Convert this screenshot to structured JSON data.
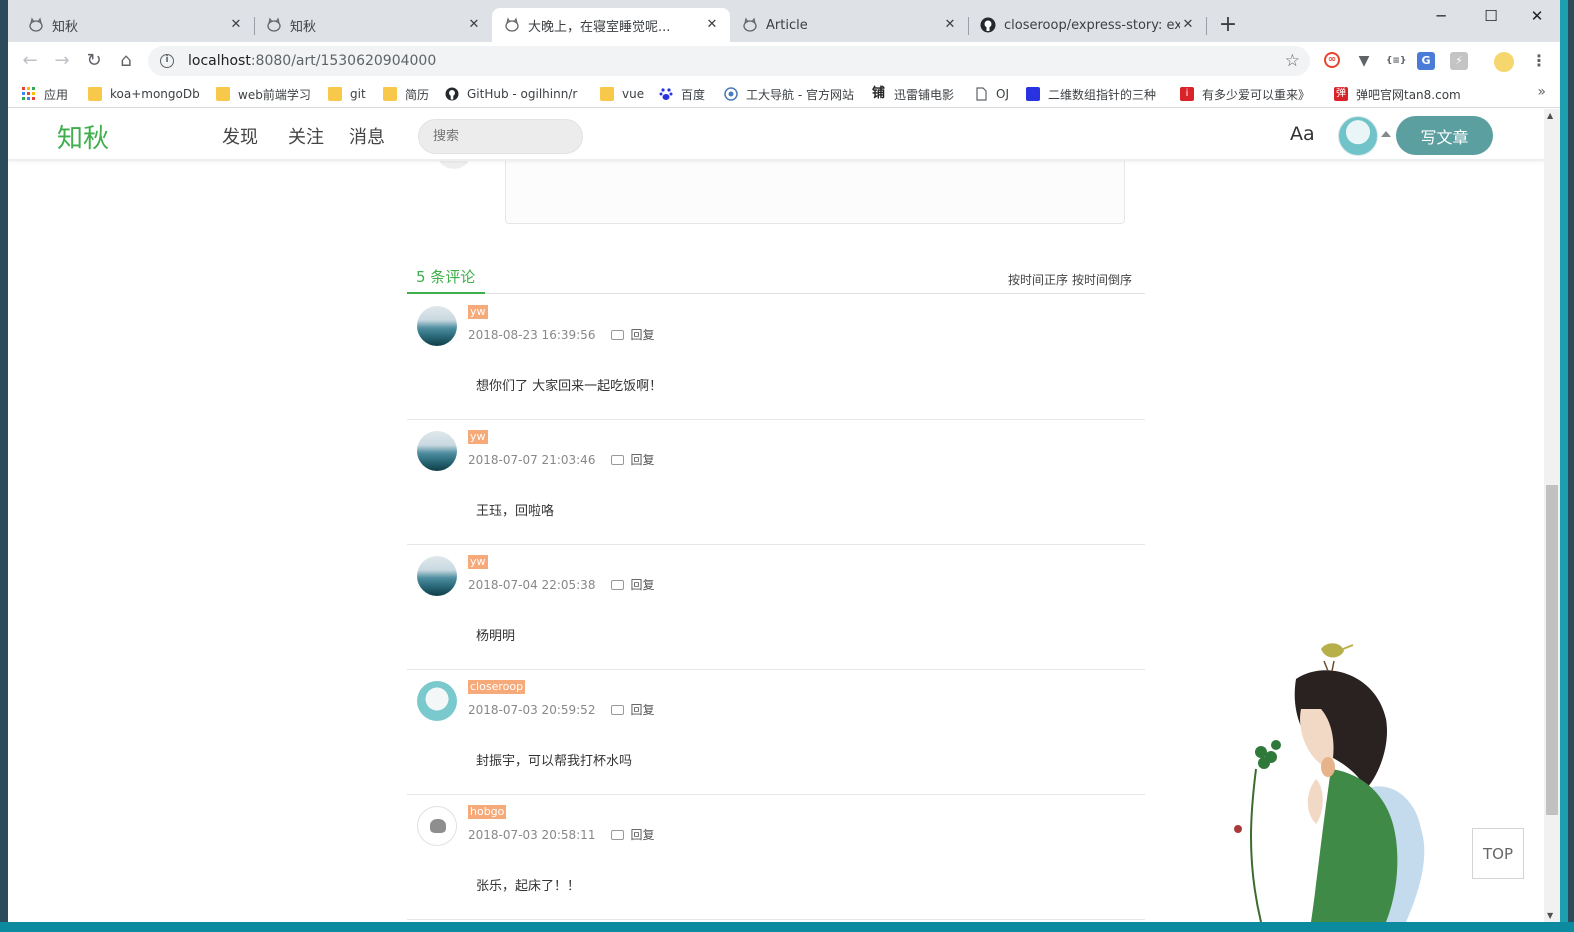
{
  "browser": {
    "tabs": [
      {
        "title": "知秋",
        "active": false
      },
      {
        "title": "知秋",
        "active": false
      },
      {
        "title": "大晚上，在寝室睡觉呢...",
        "active": true
      },
      {
        "title": "Article",
        "active": false
      },
      {
        "title": "closeroop/express-story: expre",
        "active": false
      }
    ],
    "tab_close": "✕",
    "new_tab": "+",
    "window_controls": {
      "minimize": "─",
      "maximize": "☐",
      "close": "✕"
    },
    "nav": {
      "back": "←",
      "forward": "→",
      "reload": "↻",
      "home": "⌂"
    },
    "url_host": "localhost",
    "url_path": ":8080/art/1530620904000",
    "star": "☆",
    "bookmarks": [
      {
        "label": "应用",
        "icon": "apps-grid-icon"
      },
      {
        "label": "koa+mongoDb",
        "icon": "folder-icon"
      },
      {
        "label": "web前端学习",
        "icon": "folder-icon"
      },
      {
        "label": "git",
        "icon": "folder-icon"
      },
      {
        "label": "简历",
        "icon": "folder-icon"
      },
      {
        "label": "GitHub - ogilhinn/r",
        "icon": "github-icon"
      },
      {
        "label": "vue",
        "icon": "folder-icon"
      },
      {
        "label": "百度",
        "icon": "baidu-icon"
      },
      {
        "label": "工大导航 - 官方网站",
        "icon": "globe-icon"
      },
      {
        "label": "迅雷铺电影",
        "icon": "xunlei-icon"
      },
      {
        "label": "OJ",
        "icon": "page-icon"
      },
      {
        "label": "二维数组指针的三种",
        "icon": "baidu-icon"
      },
      {
        "label": "有多少爱可以重来》",
        "icon": "red-i-icon"
      },
      {
        "label": "弹吧官网tan8.com",
        "icon": "tan8-icon"
      }
    ],
    "bookmarks_more": "»"
  },
  "site": {
    "logo": "知秋",
    "nav": [
      "发现",
      "关注",
      "消息"
    ],
    "search_placeholder": "搜索",
    "font_toggle": "Aa",
    "write_button": "写文章",
    "accent": "#3eaf4b",
    "write_color": "#5b9fa0"
  },
  "comments": {
    "count_label": "5 条评论",
    "sort_asc": "按时间正序",
    "sort_desc": "按时间倒序",
    "reply_label": "回复",
    "items": [
      {
        "user": "yw",
        "time": "2018-08-23 16:39:56",
        "text": "想你们了 大家回来一起吃饭啊！",
        "avatar": "sea"
      },
      {
        "user": "yw",
        "time": "2018-07-07 21:03:46",
        "text": "王珏，回啦咯",
        "avatar": "sea"
      },
      {
        "user": "yw",
        "time": "2018-07-04 22:05:38",
        "text": "杨明明",
        "avatar": "sea"
      },
      {
        "user": "closeroop",
        "time": "2018-07-03 20:59:52",
        "text": "封振宇，可以帮我打杯水吗",
        "avatar": "anime"
      },
      {
        "user": "hobgo",
        "time": "2018-07-03 20:58:11",
        "text": "张乐，起床了！！",
        "avatar": "pusheen"
      }
    ]
  },
  "top_button": "TOP"
}
